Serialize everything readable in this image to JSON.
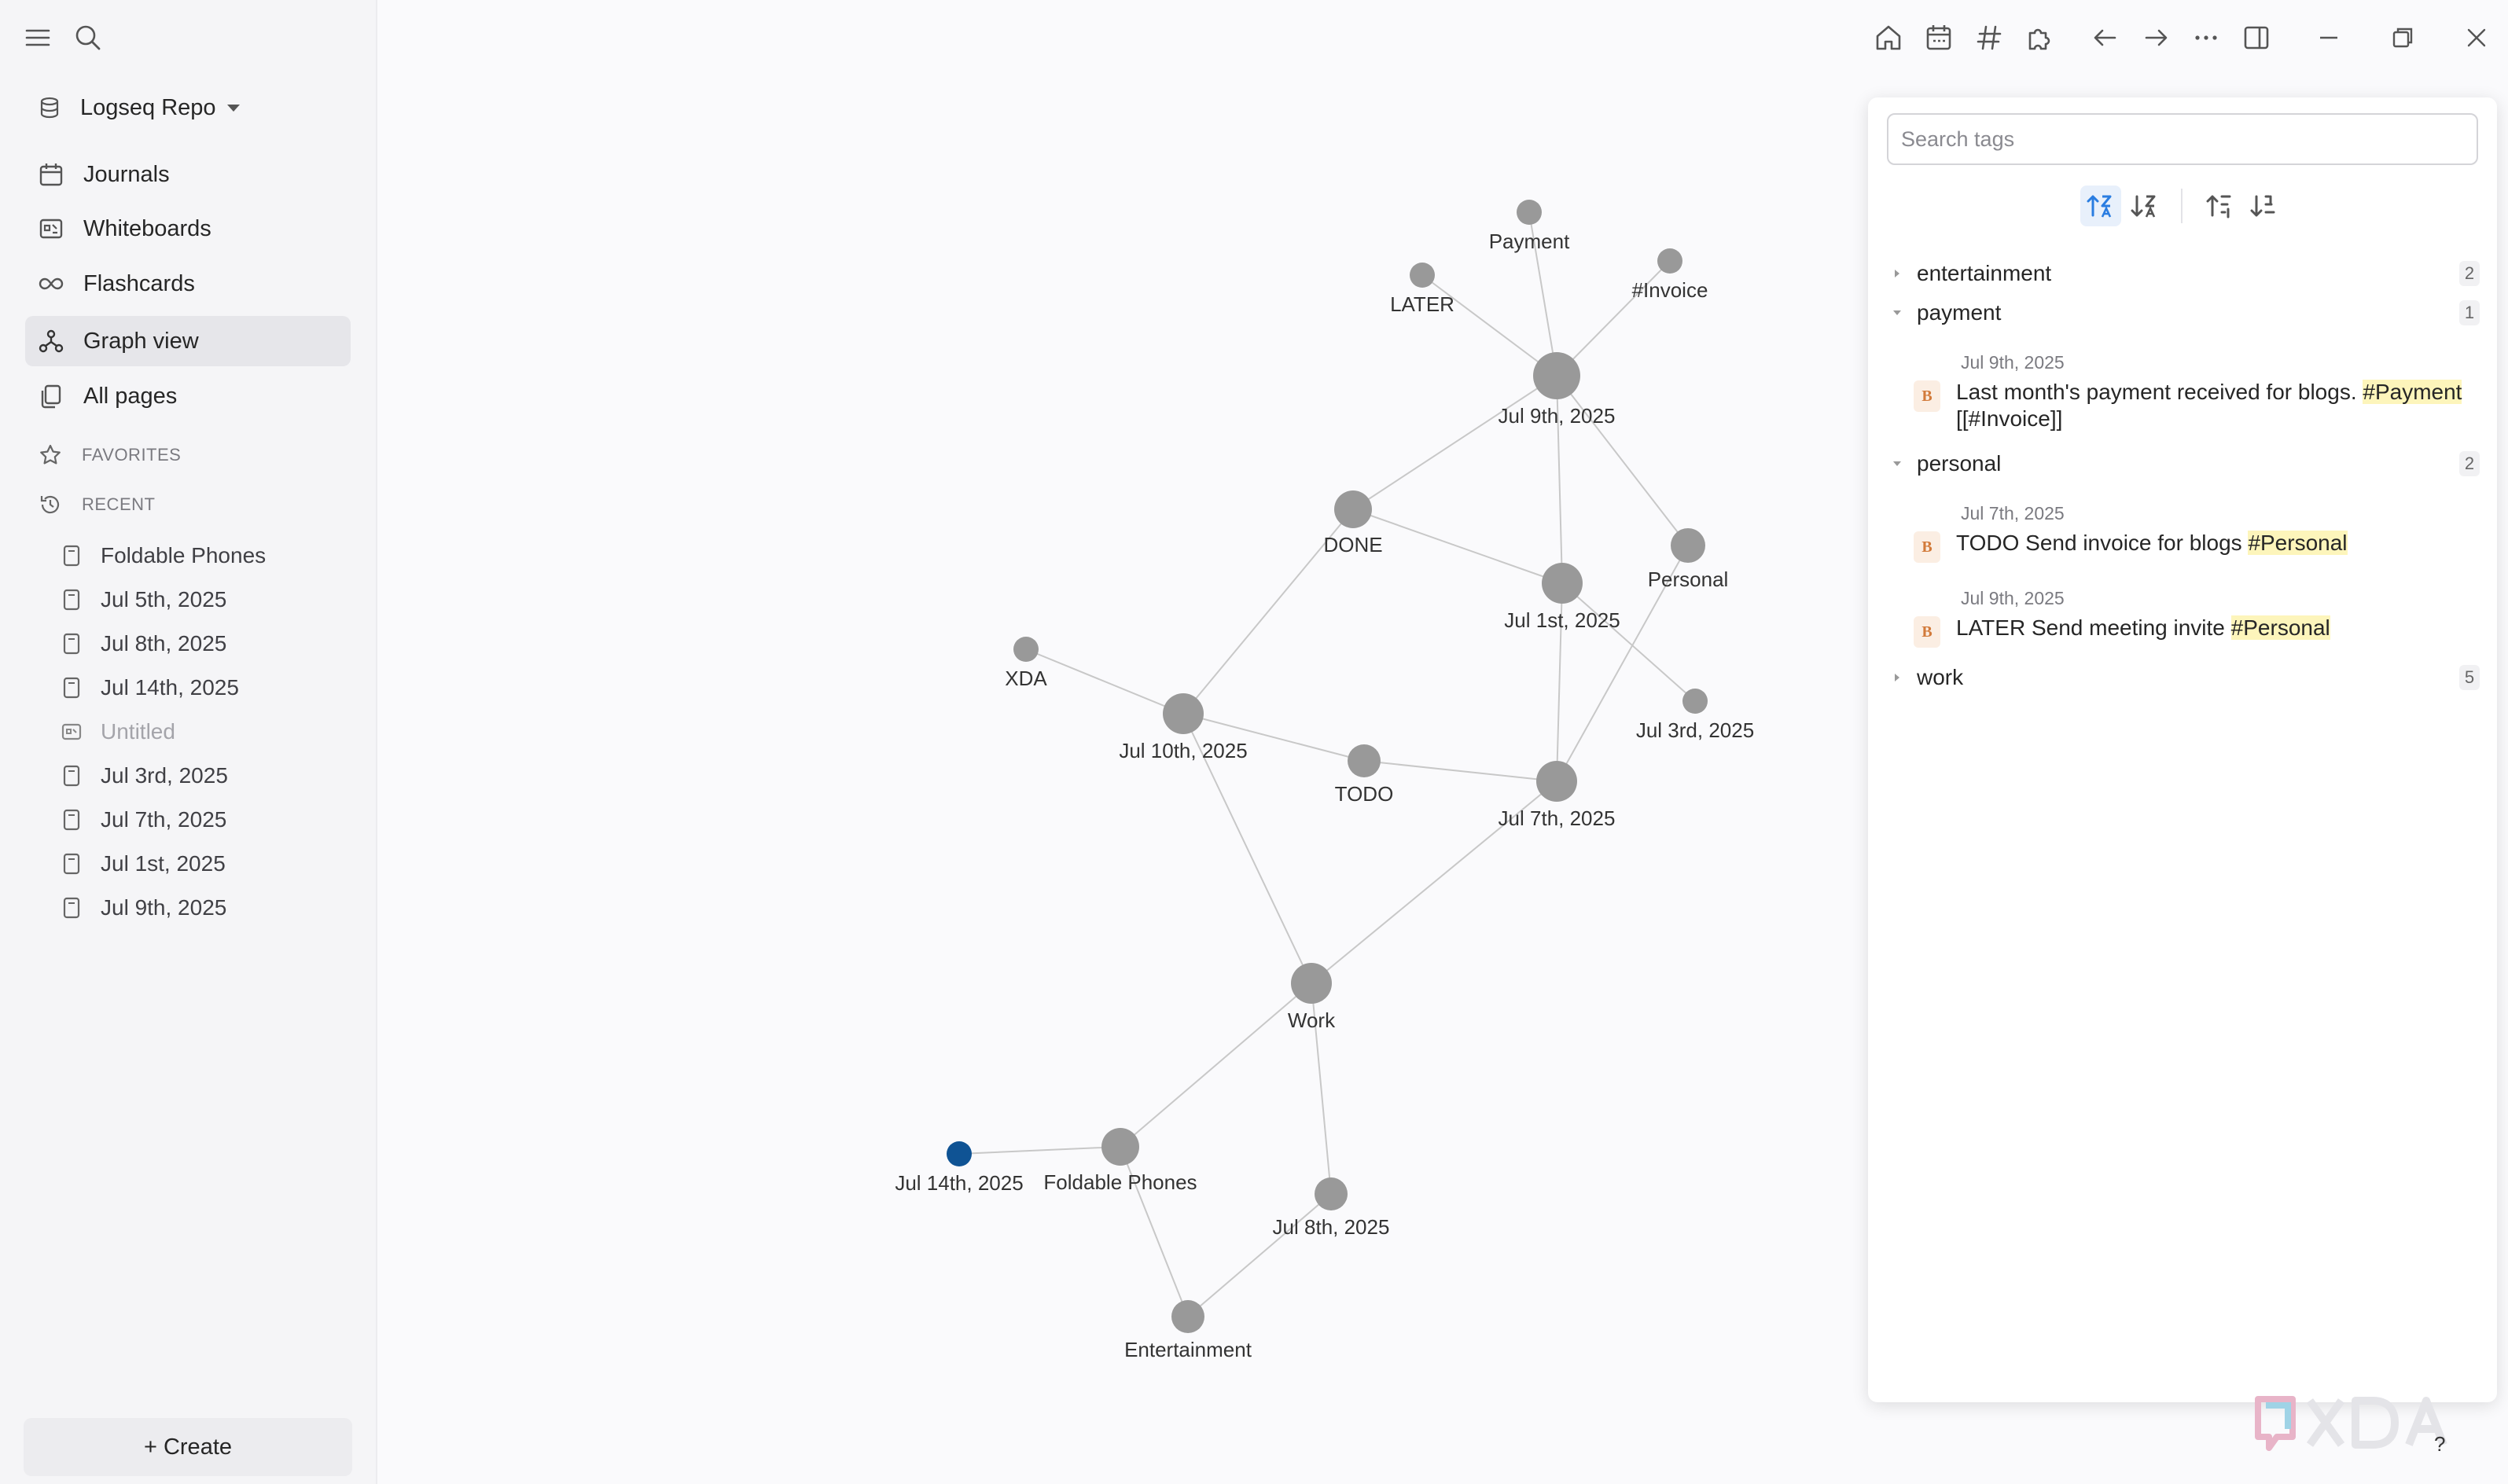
{
  "app": {
    "repo_name": "Logseq Repo"
  },
  "sidebar": {
    "nav": [
      {
        "label": "Journals",
        "icon": "calendar-icon"
      },
      {
        "label": "Whiteboards",
        "icon": "whiteboard-icon"
      },
      {
        "label": "Flashcards",
        "icon": "infinity-icon"
      },
      {
        "label": "Graph view",
        "icon": "graph-icon",
        "active": true
      },
      {
        "label": "All pages",
        "icon": "pages-icon"
      }
    ],
    "favorites_label": "FAVORITES",
    "recent_label": "RECENT",
    "recent": [
      {
        "label": "Foldable Phones"
      },
      {
        "label": "Jul 5th, 2025"
      },
      {
        "label": "Jul 8th, 2025"
      },
      {
        "label": "Jul 14th, 2025"
      },
      {
        "label": "Untitled",
        "muted": true
      },
      {
        "label": "Jul 3rd, 2025"
      },
      {
        "label": "Jul 7th, 2025"
      },
      {
        "label": "Jul 1st, 2025"
      },
      {
        "label": "Jul 9th, 2025"
      }
    ],
    "create_label": "+ Create"
  },
  "toolbar": {
    "icons": [
      "home-icon",
      "journal-calendar-icon",
      "hashtag-icon",
      "plugins-icon",
      "back-arrow-icon",
      "forward-arrow-icon",
      "more-icon",
      "sidebar-toggle-icon",
      "minimize-icon",
      "restore-icon",
      "close-icon"
    ]
  },
  "graph": {
    "colors": {
      "node": "#999999",
      "selected": "#0f5394",
      "edge": "#c8c8c8"
    },
    "nodes": [
      {
        "id": "Payment",
        "label": "Payment"
      },
      {
        "id": "LATER",
        "label": "LATER"
      },
      {
        "id": "Invoice",
        "label": "#Invoice"
      },
      {
        "id": "Jul9",
        "label": "Jul 9th, 2025"
      },
      {
        "id": "DONE",
        "label": "DONE"
      },
      {
        "id": "Personal",
        "label": "Personal"
      },
      {
        "id": "Jul1",
        "label": "Jul 1st, 2025"
      },
      {
        "id": "XDA",
        "label": "XDA"
      },
      {
        "id": "Jul3",
        "label": "Jul 3rd, 2025"
      },
      {
        "id": "Jul10",
        "label": "Jul 10th, 2025"
      },
      {
        "id": "TODO",
        "label": "TODO"
      },
      {
        "id": "Jul7",
        "label": "Jul 7th, 2025"
      },
      {
        "id": "Work",
        "label": "Work"
      },
      {
        "id": "Jul14",
        "label": "Jul 14th, 2025",
        "selected": true
      },
      {
        "id": "Foldable",
        "label": "Foldable Phones"
      },
      {
        "id": "Jul8",
        "label": "Jul 8th, 2025"
      },
      {
        "id": "Entertainment",
        "label": "Entertainment"
      }
    ],
    "edges": [
      [
        "Payment",
        "Jul9"
      ],
      [
        "LATER",
        "Jul9"
      ],
      [
        "Invoice",
        "Jul9"
      ],
      [
        "Jul9",
        "DONE"
      ],
      [
        "Jul9",
        "Jul1"
      ],
      [
        "Jul9",
        "Personal"
      ],
      [
        "DONE",
        "Jul1"
      ],
      [
        "DONE",
        "Jul10"
      ],
      [
        "Jul1",
        "Jul7"
      ],
      [
        "Jul1",
        "Jul3"
      ],
      [
        "Personal",
        "Jul7"
      ],
      [
        "XDA",
        "Jul10"
      ],
      [
        "Jul10",
        "TODO"
      ],
      [
        "TODO",
        "Jul7"
      ],
      [
        "Jul10",
        "Work"
      ],
      [
        "Jul7",
        "Work"
      ],
      [
        "Work",
        "Foldable"
      ],
      [
        "Work",
        "Jul8"
      ],
      [
        "Jul14",
        "Foldable"
      ],
      [
        "Foldable",
        "Entertainment"
      ],
      [
        "Jul8",
        "Entertainment"
      ]
    ]
  },
  "tags_panel": {
    "search_placeholder": "Search tags",
    "sort_buttons": [
      "sort-alpha-asc-icon",
      "sort-alpha-desc-icon",
      "sort-count-asc-icon",
      "sort-count-desc-icon"
    ],
    "tags": [
      {
        "name": "entertainment",
        "count": "2",
        "expanded": false
      },
      {
        "name": "payment",
        "count": "1",
        "expanded": true
      },
      {
        "name": "personal",
        "count": "2",
        "expanded": true
      },
      {
        "name": "work",
        "count": "5",
        "expanded": false
      }
    ],
    "entries": {
      "payment_1": {
        "date": "Jul 9th, 2025",
        "text": "Last month's payment received for blogs. ",
        "tag": "#Payment",
        "extra": "[[#Invoice]]"
      },
      "personal_1": {
        "date": "Jul 7th, 2025",
        "text": "TODO Send invoice for blogs ",
        "tag": "#Personal"
      },
      "personal_2": {
        "date": "Jul 9th, 2025",
        "text": "LATER Send meeting invite ",
        "tag": "#Personal"
      }
    },
    "block_badge": "B"
  },
  "help_label": "?"
}
